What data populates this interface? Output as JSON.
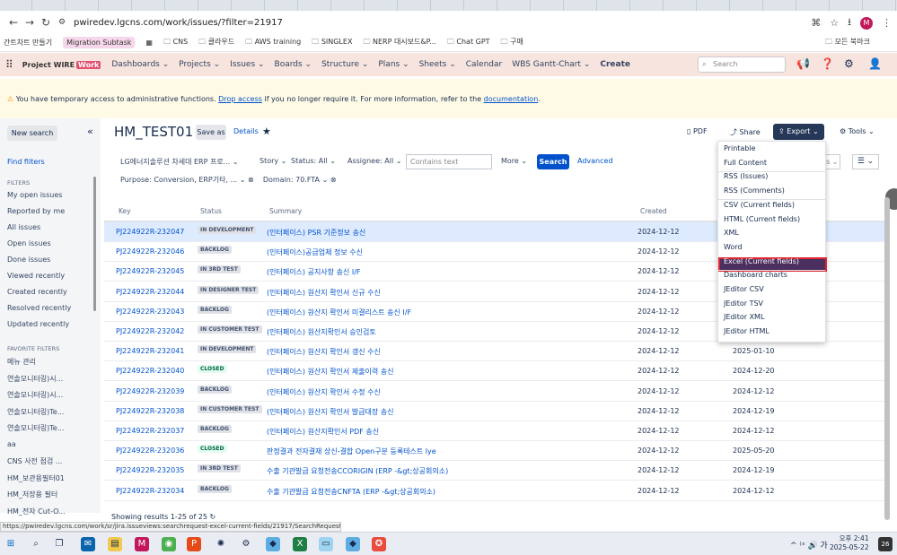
{
  "browser": {
    "url": "pwiredev.lgcns.com/work/issues/?filter=21917",
    "tabs": [
      "",
      "",
      "",
      "",
      "",
      "",
      "",
      "",
      "",
      "",
      "",
      "",
      "",
      "",
      "",
      "",
      "",
      "",
      "",
      "",
      "",
      "",
      "",
      "",
      "",
      "",
      ""
    ]
  },
  "bookmarks": [
    {
      "label": "간트차트 만들기",
      "style": "plain"
    },
    {
      "label": "Migration Subtask",
      "style": "pink"
    },
    {
      "label": "CNS",
      "style": "folder"
    },
    {
      "label": "클라우드",
      "style": "folder"
    },
    {
      "label": "AWS training",
      "style": "folder"
    },
    {
      "label": "SINGLEX",
      "style": "folder"
    },
    {
      "label": "NERP 대시보드&P...",
      "style": "folder"
    },
    {
      "label": "Chat GPT",
      "style": "folder"
    },
    {
      "label": "구매",
      "style": "folder"
    }
  ],
  "bookmarks_right": "모든 북마크",
  "nav": {
    "logo_text": "Project WIRE",
    "logo_badge": "Work",
    "items": [
      "Dashboards ⌄",
      "Projects ⌄",
      "Issues ⌄",
      "Boards ⌄",
      "Structure ⌄",
      "Plans ⌄",
      "Sheets ⌄",
      "Calendar",
      "WBS Gantt-Chart ⌄",
      "Create"
    ],
    "search_placeholder": "Search"
  },
  "banner": {
    "text1": "You have temporary access to administrative functions.",
    "link1": "Drop access",
    "text2": "if you no longer require it. For more information, refer to the",
    "link2": "documentation",
    "text3": "."
  },
  "sidebar": {
    "new_search": "New search",
    "find_filters": "Find filters",
    "filters_header": "FILTERS",
    "filters": [
      "My open issues",
      "Reported by me",
      "All issues",
      "Open issues",
      "Done issues",
      "Viewed recently",
      "Created recently",
      "Resolved recently",
      "Updated recently"
    ],
    "favorite_header": "FAVORITE FILTERS",
    "favorites": [
      "메뉴 관리",
      "연솔모니터링)시...",
      "연솔모니터링)시...",
      "연솔모니터링)Te...",
      "연솔모니터링)Te...",
      "aa",
      "CNS 사전 점검 ...",
      "HM_보관용필터01",
      "HM_저장용 필터",
      "HM_전자 Cut-O..."
    ]
  },
  "header": {
    "title": "HM_TEST01",
    "save_as": "Save as",
    "details": "Details",
    "pdf": "PDF",
    "share": "Share",
    "export": "Export ⌄",
    "tools": "Tools ⌄"
  },
  "query": {
    "project": "LG에너지솔루션 차세대 ERP 프로... ⌄",
    "type": "Story ⌄",
    "status": "Status: All ⌄",
    "assignee": "Assignee: All ⌄",
    "contains_placeholder": "Contains text",
    "more": "More ⌄",
    "search": "Search",
    "advanced": "Advanced",
    "purpose": "Purpose: Conversion, ERP기타, ... ⌄",
    "domain": "Domain: 70.FTA ⌄",
    "columns_partial": "ns ⌄"
  },
  "table": {
    "headers": [
      "Key",
      "Status",
      "Summary",
      "Created"
    ],
    "rows": [
      {
        "key": "PJ224922R-232047",
        "status": "IN DEVELOPMENT",
        "summary": "(인터페이스) PSR 기준정보 송신",
        "created": "2024-12-12",
        "updated": ""
      },
      {
        "key": "PJ224922R-232046",
        "status": "BACKLOG",
        "summary": "(인터페이스)공급업체 정보 수신",
        "created": "2024-12-12",
        "updated": ""
      },
      {
        "key": "PJ224922R-232045",
        "status": "IN 3RD TEST",
        "summary": "(인터페이스) 공지사항 송신 I/F",
        "created": "2024-12-12",
        "updated": ""
      },
      {
        "key": "PJ224922R-232044",
        "status": "IN DESIGNER TEST",
        "summary": "(인터페이스) 원산지 확인서 신규 수신",
        "created": "2024-12-12",
        "updated": ""
      },
      {
        "key": "PJ224922R-232043",
        "status": "BACKLOG",
        "summary": "(인터페이스) 원산지 확인서 미결리스트 송신 I/F",
        "created": "2024-12-12",
        "updated": ""
      },
      {
        "key": "PJ224922R-232042",
        "status": "IN CUSTOMER TEST",
        "summary": "(인터페이스) 원산지확인서 승인검토",
        "created": "2024-12-12",
        "updated": ""
      },
      {
        "key": "PJ224922R-232041",
        "status": "IN DEVELOPMENT",
        "summary": "(인터페이스) 원산지 확인서 갱신 수신",
        "created": "2024-12-12",
        "updated": "2025-01-10"
      },
      {
        "key": "PJ224922R-232040",
        "status": "CLOSED",
        "summary": "(인터페이스) 원산지 확인서 제출이력 송신",
        "created": "2024-12-12",
        "updated": "2024-12-20"
      },
      {
        "key": "PJ224922R-232039",
        "status": "BACKLOG",
        "summary": "(인터페이스) 원산지 확인서 수정 수신",
        "created": "2024-12-12",
        "updated": "2024-12-12"
      },
      {
        "key": "PJ224922R-232038",
        "status": "IN CUSTOMER TEST",
        "summary": "(인터페이스) 원산지 확인서 발급대장 송신",
        "created": "2024-12-12",
        "updated": "2024-12-19"
      },
      {
        "key": "PJ224922R-232037",
        "status": "BACKLOG",
        "summary": "(인터페이스) 원산지확인서 PDF 송신",
        "created": "2024-12-12",
        "updated": "2024-12-12"
      },
      {
        "key": "PJ224922R-232036",
        "status": "CLOSED",
        "summary": "판정결과 전자결재 상신-결합 Open구분 등록테스트 lye",
        "created": "2024-12-12",
        "updated": "2025-05-20"
      },
      {
        "key": "PJ224922R-232035",
        "status": "IN 3RD TEST",
        "summary": "수출 기관발급 요청전송CCORIGIN (ERP -&gt;상공회의소)",
        "created": "2024-12-12",
        "updated": "2024-12-19"
      },
      {
        "key": "PJ224922R-232034",
        "status": "BACKLOG",
        "summary": "수출 기관발급 요청전송CNFTA (ERP -&gt;상공회의소)",
        "created": "2024-12-12",
        "updated": "2024-12-12"
      }
    ],
    "showing": "Showing results 1-25 of 25"
  },
  "export_menu": {
    "items": [
      "Printable",
      "Full Content",
      "RSS (Issues)",
      "RSS (Comments)",
      "CSV (Current fields)",
      "HTML (Current fields)",
      "XML",
      "Word",
      "Excel (Current fields)",
      "Dashboard charts",
      "JEditor CSV",
      "JEditor TSV",
      "JEditor XML",
      "JEditor HTML"
    ],
    "highlighted": "Excel (Current fields)"
  },
  "status_url": "https://pwiredev.lgcns.com/work/sr/jira.issueviews:searchrequest-excel-current-fields/21917/SearchRequest-21917.xls",
  "taskbar": {
    "time": "오후 2:41",
    "date": "2025-05-22",
    "badge": "26"
  }
}
